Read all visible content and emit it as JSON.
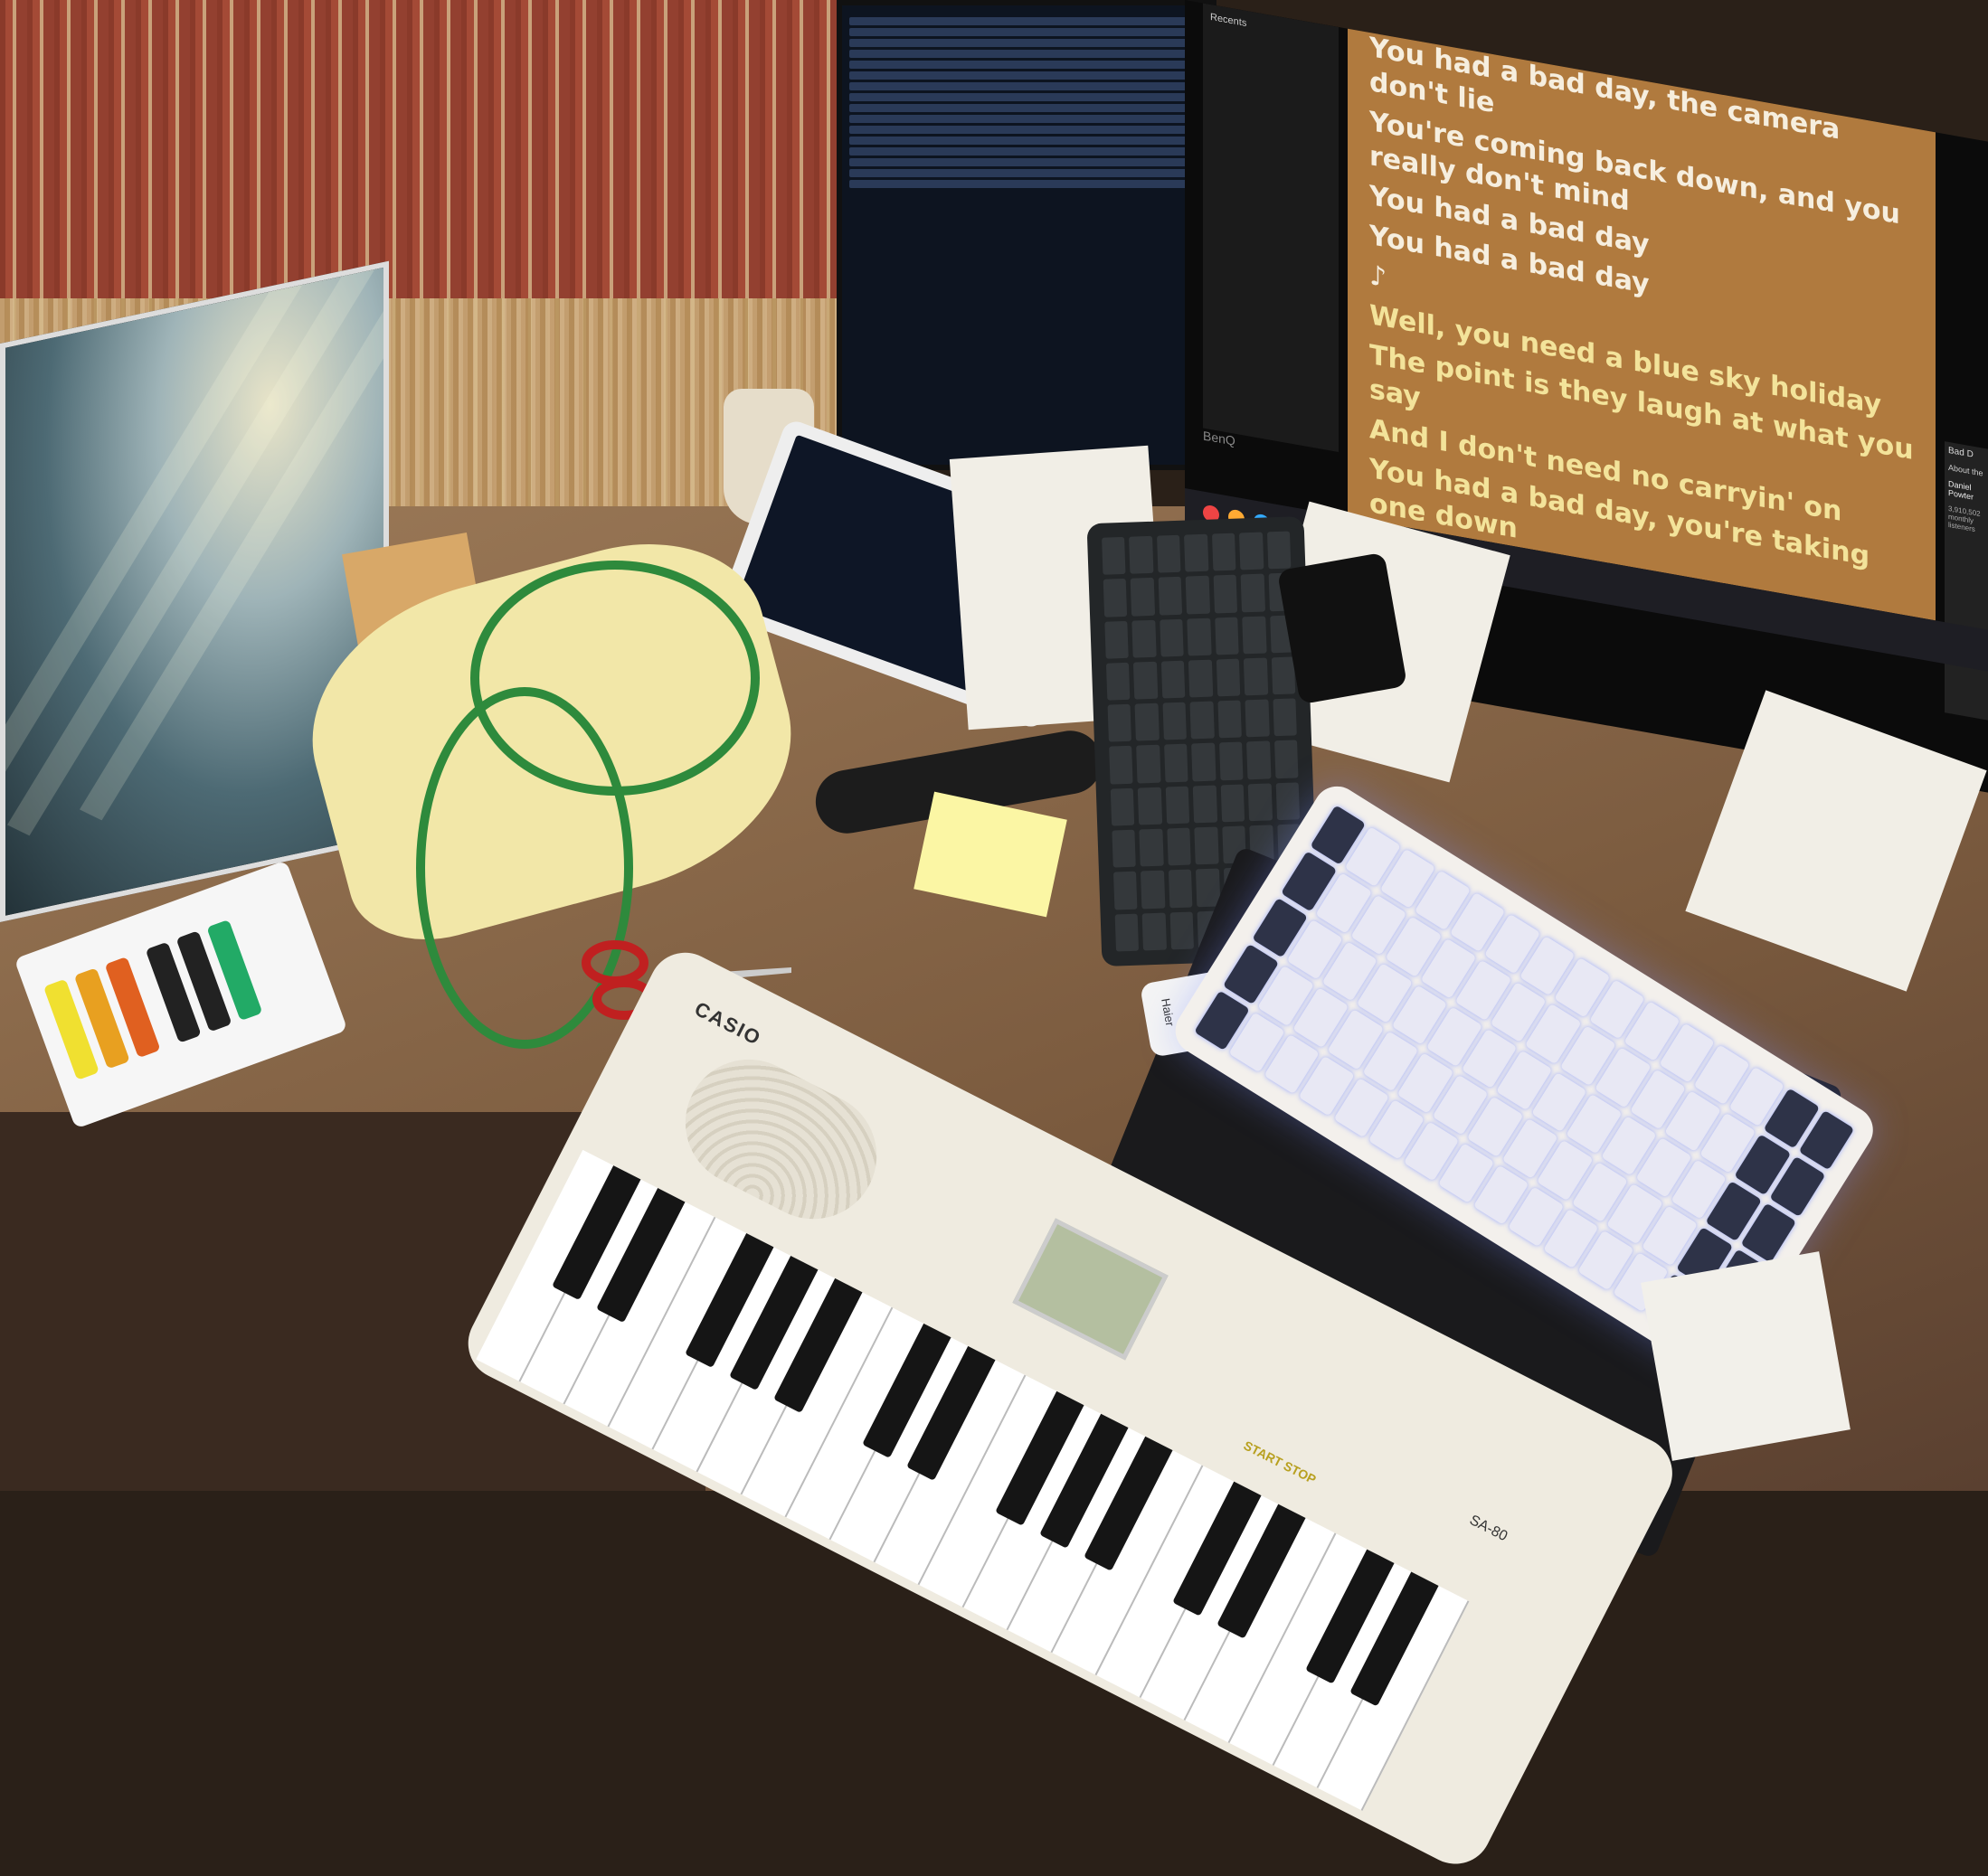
{
  "lyrics": {
    "lines": [
      "You had a bad day, the camera don't lie",
      "You're coming back down, and you really don't mind",
      "You had a bad day",
      "You had a bad day",
      "♪",
      "Well, you need a blue sky holiday",
      "The point is they laugh at what you say",
      "And I don't need no carryin' on",
      "You had a bad day, you're taking one down"
    ]
  },
  "spotify": {
    "recents_label": "Recents",
    "artist_name": "Daniel Powter",
    "monthly_listeners": "3,910,502 monthly listeners",
    "about_label": "About the",
    "bad_day_label": "Bad D"
  },
  "monitor_brand": "BenQ",
  "casio": {
    "brand": "CASIO",
    "model": "SA-80",
    "start_stop": "START STOP"
  },
  "remote_brand": "Haier",
  "colors": {
    "lyrics_bg": "#b07a3e",
    "current_lyric": "#f6eede",
    "upcoming_lyric": "#f3e39a",
    "thread": "#2e8a3c"
  }
}
